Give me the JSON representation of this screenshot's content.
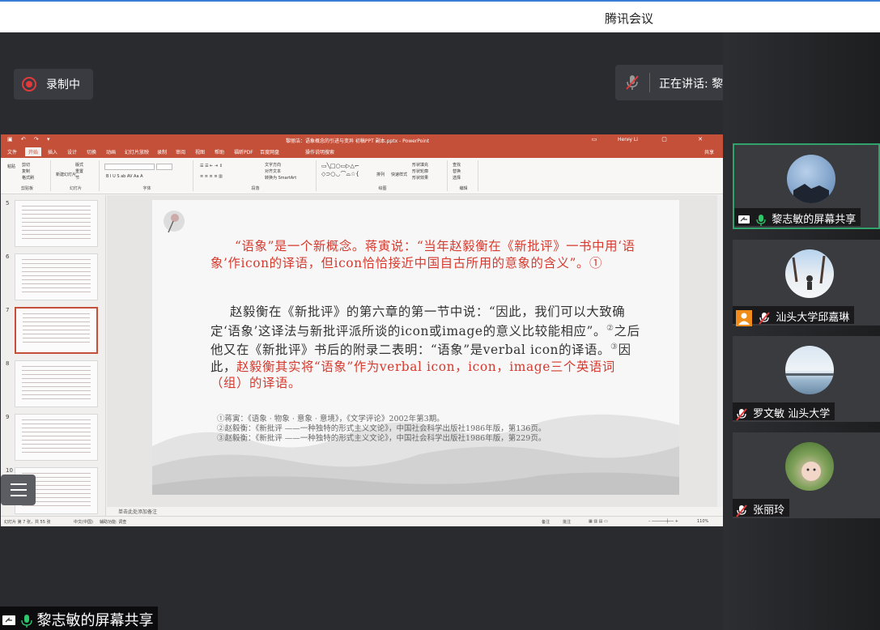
{
  "app": {
    "title": "腾讯会议"
  },
  "recording": {
    "label": "录制中"
  },
  "speaking": {
    "label": "正在讲话: 黎志敏;"
  },
  "ppt": {
    "doc_title": "黎丽洁：语象概念的引进与变异 初稿PPT 副本.pptx - PowerPoint",
    "user": "Henry Li",
    "tabs": [
      "文件",
      "开始",
      "插入",
      "设计",
      "切换",
      "动画",
      "幻灯片放映",
      "录制",
      "审阅",
      "视图",
      "帮助",
      "福昕PDF",
      "百度网盘",
      "操作说明搜索"
    ],
    "active_tab": "开始",
    "share_label": "共享",
    "ribbon_groups": [
      "剪贴板",
      "幻灯片",
      "字体",
      "段落",
      "绘图",
      "编辑"
    ],
    "ribbon_items": {
      "paste": "粘贴",
      "cut": "剪切",
      "copy": "复制",
      "format_painter": "格式刷",
      "new_slide": "新建幻灯片",
      "layout": "版式",
      "reset": "重置",
      "section": "节",
      "text_direction": "文字方向",
      "align_text": "对齐文本",
      "smartart": "转换为 SmartArt",
      "arrange": "排列",
      "quick_styles": "快速样式",
      "shape_fill": "形状填充",
      "shape_outline": "形状轮廓",
      "shape_effect": "形状效果",
      "find": "查找",
      "replace": "替换",
      "select": "选择"
    },
    "thumbnails": [
      "5",
      "6",
      "7",
      "8",
      "9",
      "10"
    ],
    "selected_thumb": "7",
    "slide": {
      "p1": "“语象”是一个新概念。蒋寅说：“当年赵毅衡在《新批评》一书中用‘语象’作icon的译语，但icon恰恰接近中国自古所用的意象的含义”。①",
      "p2_a": "赵毅衡在《新批评》的第六章的第一节中说：“因此，我们可以大致确定‘语象’这译法与新批评派所谈的icon或image的意义比较能相应”。",
      "p2_sup2": "②",
      "p2_b": "之后他又在《新批评》书后的附录二表明：“语象”是verbal icon的译语。",
      "p2_sup3": "③",
      "p2_c": "因此，",
      "p2_red": "赵毅衡其实将“语象”作为verbal icon，icon，image三个英语词（组）的译语。",
      "notes": [
        "①蒋寅：《语象 · 物象 · 意象 · 意境》，《文学评论》2002年第3期。",
        "②赵毅衡：《新批评 ——一种独特的形式主义文论》，中国社会科学出版社1986年版，第136页。",
        "③赵毅衡：《新批评 ——一种独特的形式主义文论》，中国社会科学出版社1986年版，第229页。"
      ]
    },
    "notes_hint": "单击此处添加备注",
    "status": {
      "slide_count": "幻灯片 第 7 张，共 55 张",
      "language": "中文(中国)",
      "accessibility": "辅助功能: 调查",
      "notes": "备注",
      "comments": "批注",
      "zoom": "110%"
    }
  },
  "participants": [
    {
      "name": "黎志敏的屏幕共享",
      "active": true
    },
    {
      "name": "汕头大学邱嘉琳",
      "active": false
    },
    {
      "name": "罗文敏 汕头大学",
      "active": false
    },
    {
      "name": "张丽玲",
      "active": false
    }
  ],
  "bottom_tag": {
    "label": "黎志敏的屏幕共享"
  },
  "colors": {
    "accent_green": "#2fa36b",
    "ppt_red": "#c4503a",
    "record_red": "#e03b3b",
    "slide_red": "#d63a2e"
  }
}
